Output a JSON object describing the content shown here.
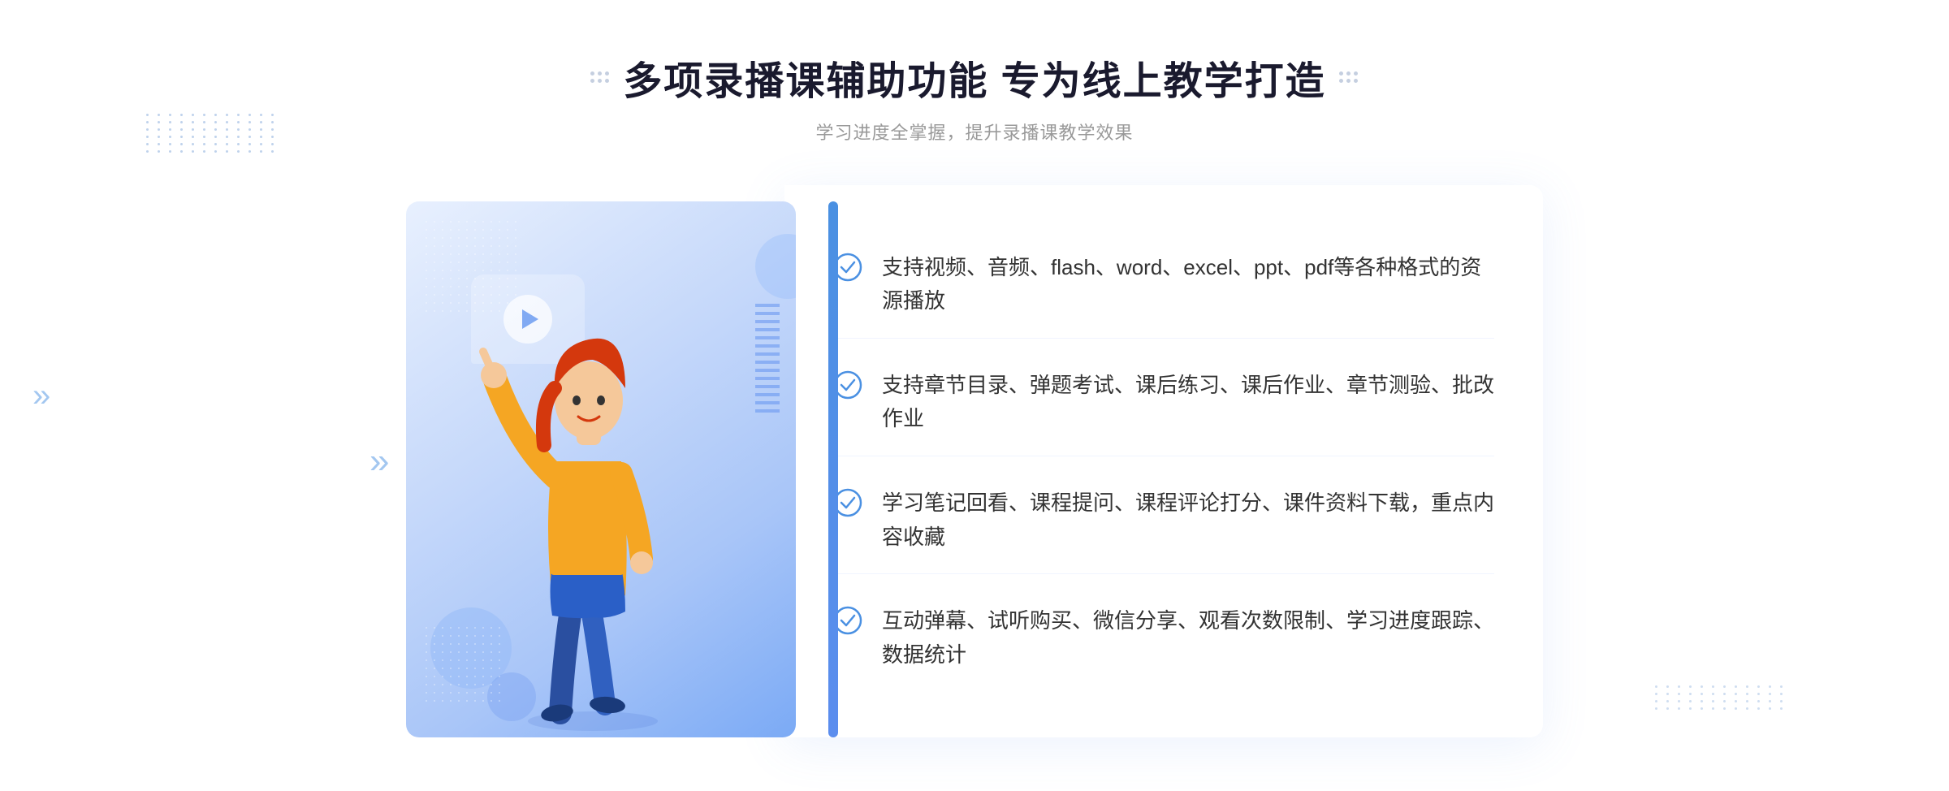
{
  "header": {
    "main_title": "多项录播课辅助功能 专为线上教学打造",
    "sub_title": "学习进度全掌握，提升录播课教学效果"
  },
  "features": [
    {
      "id": 1,
      "text": "支持视频、音频、flash、word、excel、ppt、pdf等各种格式的资源播放"
    },
    {
      "id": 2,
      "text": "支持章节目录、弹题考试、课后练习、课后作业、章节测验、批改作业"
    },
    {
      "id": 3,
      "text": "学习笔记回看、课程提问、课程评论打分、课件资料下载，重点内容收藏"
    },
    {
      "id": 4,
      "text": "互动弹幕、试听购买、微信分享、观看次数限制、学习进度跟踪、数据统计"
    }
  ],
  "colors": {
    "accent_blue": "#4a90e2",
    "light_blue": "#5b8dee",
    "title_color": "#1a1a2e",
    "text_color": "#333333",
    "sub_text": "#999999"
  }
}
